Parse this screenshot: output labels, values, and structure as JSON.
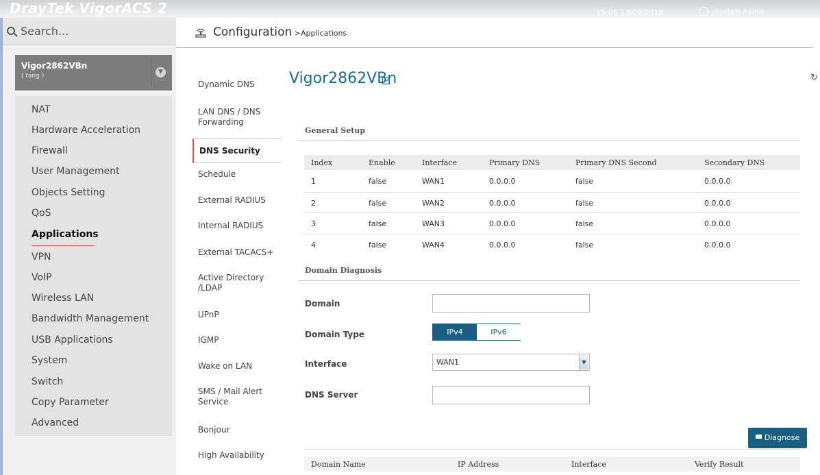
{
  "header": {
    "brand": "DrayTek VigorACS 2",
    "datetime": "15:05 13/09/2018",
    "user": "System.Admin"
  },
  "search": {
    "label": "Search..."
  },
  "device_card": {
    "name": "Vigor2862VBn",
    "sub": "( tang )"
  },
  "sidebar": {
    "items": [
      {
        "label": "NAT"
      },
      {
        "label": "Hardware Acceleration"
      },
      {
        "label": "Firewall"
      },
      {
        "label": "User Management"
      },
      {
        "label": "Objects Setting"
      },
      {
        "label": "QoS"
      },
      {
        "label": "Applications",
        "active": true
      },
      {
        "label": "VPN"
      },
      {
        "label": "VoIP"
      },
      {
        "label": "Wireless LAN"
      },
      {
        "label": "Bandwidth Management"
      },
      {
        "label": "USB Applications"
      },
      {
        "label": "System"
      },
      {
        "label": "Switch"
      },
      {
        "label": "Copy Parameter"
      },
      {
        "label": "Advanced"
      }
    ]
  },
  "breadcrumb": {
    "title": "Configuration",
    "sub": " >Applications"
  },
  "appnav": {
    "items": [
      {
        "label": "Dynamic DNS"
      },
      {
        "label": "LAN DNS / DNS Forwarding"
      },
      {
        "label": "DNS Security",
        "active": true
      },
      {
        "label": "Schedule"
      },
      {
        "label": "External RADIUS"
      },
      {
        "label": "Internal RADIUS"
      },
      {
        "label": "External TACACS+"
      },
      {
        "label": "Active Directory /LDAP"
      },
      {
        "label": "UPnP"
      },
      {
        "label": "IGMP"
      },
      {
        "label": "Wake on LAN"
      },
      {
        "label": "SMS / Mail Alert Service"
      },
      {
        "label": "Bonjour"
      },
      {
        "label": "High Availability"
      }
    ]
  },
  "main": {
    "device_title": "Vigor2862VBn",
    "general_setup": {
      "title": "General Setup",
      "columns": [
        "Index",
        "Enable",
        "Interface",
        "Primary DNS",
        "Primary DNS Second",
        "Secondary DNS"
      ],
      "rows": [
        [
          "1",
          "false",
          "WAN1",
          "0.0.0.0",
          "false",
          "0.0.0.0"
        ],
        [
          "2",
          "false",
          "WAN2",
          "0.0.0.0",
          "false",
          "0.0.0.0"
        ],
        [
          "3",
          "false",
          "WAN3",
          "0.0.0.0",
          "false",
          "0.0.0.0"
        ],
        [
          "4",
          "false",
          "WAN4",
          "0.0.0.0",
          "false",
          "0.0.0.0"
        ]
      ]
    },
    "domain_diagnosis": {
      "title": "Domain Diagnosis",
      "domain_label": "Domain",
      "domain_value": "",
      "domain_type_label": "Domain Type",
      "domain_type_options": [
        "IPv4",
        "IPv6"
      ],
      "domain_type_selected": "IPv4",
      "interface_label": "Interface",
      "interface_value": "WAN1",
      "dns_server_label": "DNS Server",
      "dns_server_value": "",
      "diagnose_label": "Diagnose",
      "result_columns": [
        "Domain Name",
        "IP Address",
        "Interface",
        "Verify Result"
      ]
    }
  },
  "colors": {
    "accent": "#1a5f82",
    "title_blue": "#1a6f9a",
    "active_marker": "#d9534f"
  }
}
